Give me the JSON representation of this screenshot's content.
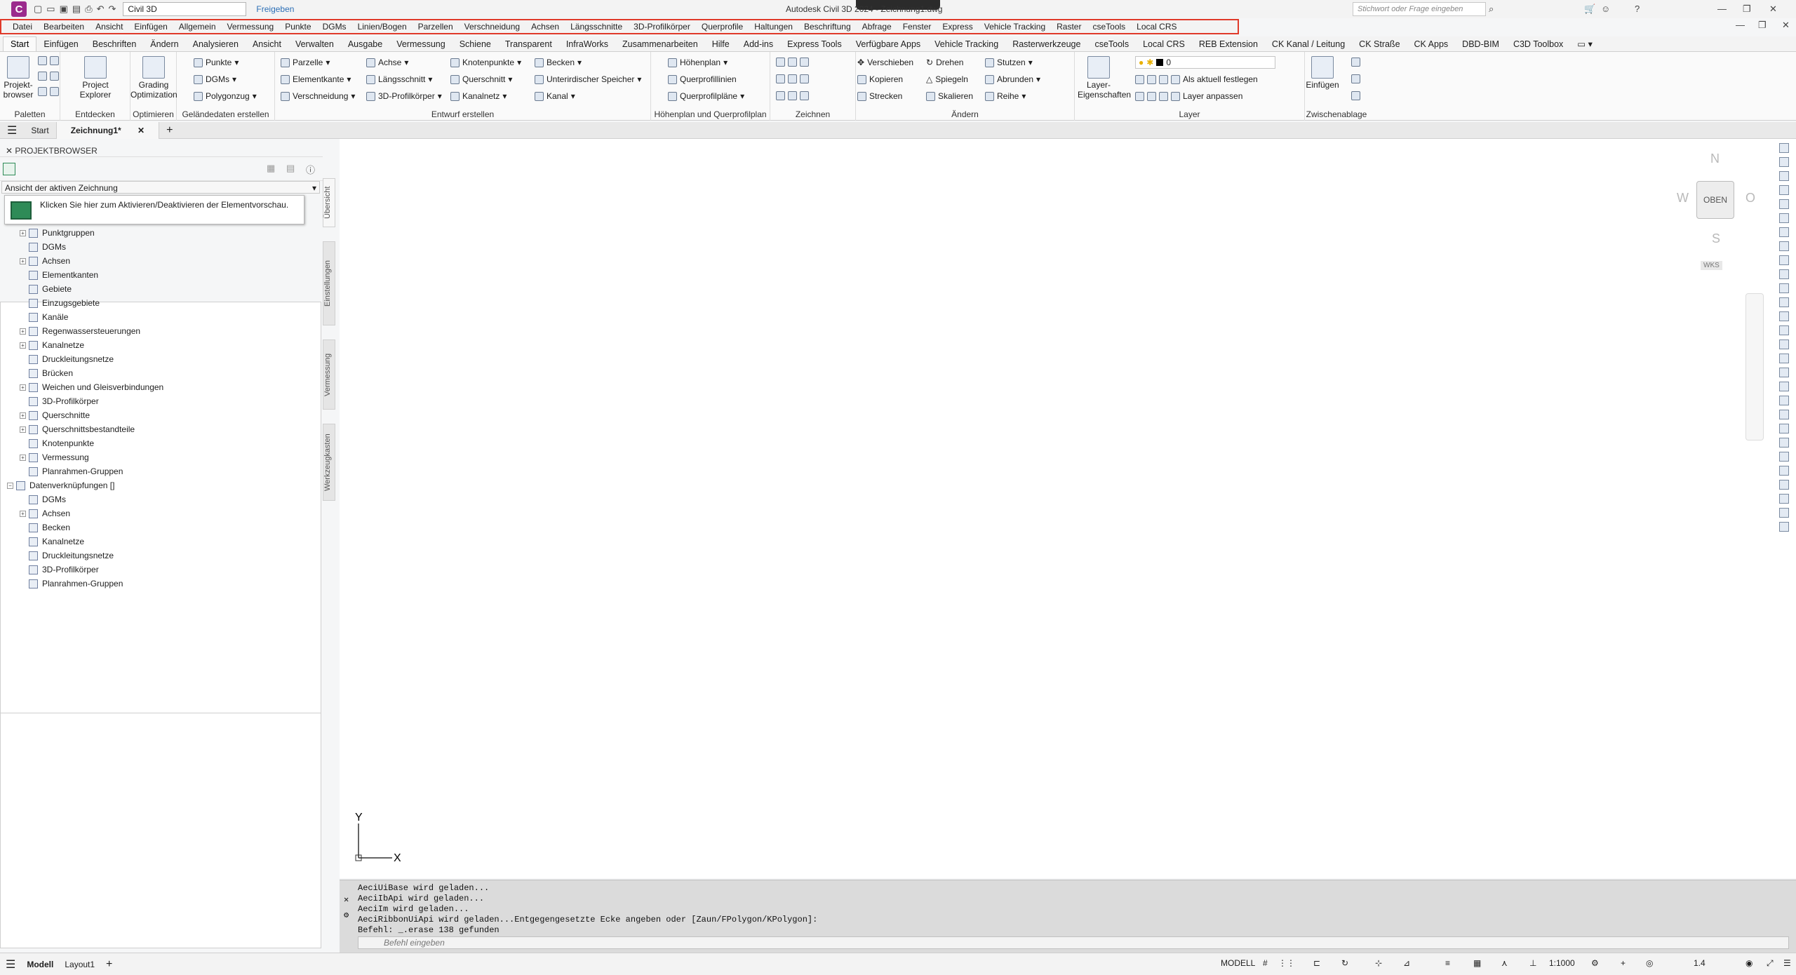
{
  "titlebar": {
    "logo": "C",
    "workspace": "Civil 3D",
    "share": "Freigeben",
    "app_title": "Autodesk Civil 3D 2024 - Zeichnung1.dwg",
    "search_placeholder": "Stichwort oder Frage eingeben"
  },
  "menu": [
    "Datei",
    "Bearbeiten",
    "Ansicht",
    "Einfügen",
    "Allgemein",
    "Vermessung",
    "Punkte",
    "DGMs",
    "Linien/Bogen",
    "Parzellen",
    "Verschneidung",
    "Achsen",
    "Längsschnitte",
    "3D-Profilkörper",
    "Querprofile",
    "Haltungen",
    "Beschriftung",
    "Abfrage",
    "Fenster",
    "Express",
    "Vehicle Tracking",
    "Raster",
    "cseTools",
    "Local CRS"
  ],
  "tabs": [
    "Start",
    "Einfügen",
    "Beschriften",
    "Ändern",
    "Analysieren",
    "Ansicht",
    "Verwalten",
    "Ausgabe",
    "Vermessung",
    "Schiene",
    "Transparent",
    "InfraWorks",
    "Zusammenarbeiten",
    "Hilfe",
    "Add-ins",
    "Express Tools",
    "Verfügbare Apps",
    "Vehicle Tracking",
    "Rasterwerkzeuge",
    "cseTools",
    "Local CRS",
    "REB Extension",
    "CK Kanal / Leitung",
    "CK Straße",
    "CK Apps",
    "DBD-BIM",
    "C3D Toolbox"
  ],
  "active_tab": "Start",
  "ribbon": {
    "panels": [
      "Paletten",
      "Entdecken",
      "Optimieren",
      "Geländedaten erstellen",
      "Entwurf erstellen",
      "Höhenplan und Querprofilplan",
      "Zeichnen",
      "Ändern",
      "Layer",
      "Zwischenablage"
    ],
    "big": {
      "projektbrowser": "Projekt-browser",
      "project_explorer": "Project Explorer",
      "grading": "Grading Optimization",
      "layer_props": "Layer-Eigenschaften",
      "einfuegen": "Einfügen"
    },
    "gelaende": [
      "Punkte",
      "DGMs",
      "Polygonzug"
    ],
    "entwurf_col1": [
      "Parzelle",
      "Elementkante",
      "Verschneidung"
    ],
    "entwurf_col2": [
      "Achse",
      "Längsschnitt",
      "3D-Profilkörper"
    ],
    "entwurf_col3": [
      "Knotenpunkte",
      "Querschnitt",
      "Kanalnetz"
    ],
    "entwurf_col4": [
      "Becken",
      "Unterirdischer Speicher",
      "Kanal"
    ],
    "hoehenplan": [
      "Höhenplan",
      "Querprofillinien",
      "Querprofilpläne"
    ],
    "aendern_col1": [
      "Verschieben",
      "Kopieren",
      "Strecken"
    ],
    "aendern_col2": [
      "Drehen",
      "Spiegeln",
      "Skalieren"
    ],
    "aendern_col3": [
      "Stutzen",
      "Abrunden",
      "Reihe"
    ],
    "layer_value": "0",
    "layer_actions": [
      "Als aktuell festlegen",
      "Layer anpassen"
    ]
  },
  "doc_tabs": [
    "Start",
    "Zeichnung1*"
  ],
  "palette": {
    "title": "PROJEKTBROWSER",
    "view_select": "Ansicht der aktiven Zeichnung",
    "tooltip": "Klicken Sie hier zum Aktivieren/Deaktivieren der Elementvorschau.",
    "side_tabs": [
      "Übersicht",
      "Einstellungen",
      "Vermessung",
      "Werkzeugkasten"
    ],
    "tree": [
      {
        "label": "Punktgruppen",
        "level": 1,
        "expand": true
      },
      {
        "label": "DGMs",
        "level": 1,
        "expand": false
      },
      {
        "label": "Achsen",
        "level": 1,
        "expand": true
      },
      {
        "label": "Elementkanten",
        "level": 1,
        "expand": false
      },
      {
        "label": "Gebiete",
        "level": 1,
        "expand": false
      },
      {
        "label": "Einzugsgebiete",
        "level": 1,
        "expand": false
      },
      {
        "label": "Kanäle",
        "level": 1,
        "expand": false
      },
      {
        "label": "Regenwassersteuerungen",
        "level": 1,
        "expand": true
      },
      {
        "label": "Kanalnetze",
        "level": 1,
        "expand": true
      },
      {
        "label": "Druckleitungsnetze",
        "level": 1,
        "expand": false
      },
      {
        "label": "Brücken",
        "level": 1,
        "expand": false
      },
      {
        "label": "Weichen und Gleisverbindungen",
        "level": 1,
        "expand": true
      },
      {
        "label": "3D-Profilkörper",
        "level": 1,
        "expand": false
      },
      {
        "label": "Querschnitte",
        "level": 1,
        "expand": true
      },
      {
        "label": "Querschnittsbestandteile",
        "level": 1,
        "expand": true
      },
      {
        "label": "Knotenpunkte",
        "level": 1,
        "expand": false
      },
      {
        "label": "Vermessung",
        "level": 1,
        "expand": true
      },
      {
        "label": "Planrahmen-Gruppen",
        "level": 1,
        "expand": false
      },
      {
        "label": "Datenverknüpfungen []",
        "level": 0,
        "expand": true
      },
      {
        "label": "DGMs",
        "level": 1,
        "expand": false
      },
      {
        "label": "Achsen",
        "level": 1,
        "expand": true
      },
      {
        "label": "Becken",
        "level": 1,
        "expand": false
      },
      {
        "label": "Kanalnetze",
        "level": 1,
        "expand": false
      },
      {
        "label": "Druckleitungsnetze",
        "level": 1,
        "expand": false
      },
      {
        "label": "3D-Profilkörper",
        "level": 1,
        "expand": false
      },
      {
        "label": "Planrahmen-Gruppen",
        "level": 1,
        "expand": false
      }
    ]
  },
  "viewcube": {
    "n": "N",
    "s": "S",
    "w": "W",
    "o": "O",
    "face": "OBEN",
    "wks": "WKS"
  },
  "ucs": {
    "x": "X",
    "y": "Y"
  },
  "command": {
    "history": [
      "AeciUiBase wird geladen...",
      "AeciIbApi wird geladen...",
      "AeciIm wird geladen...",
      "AeciRibbonUiApi wird geladen...Entgegengesetzte Ecke angeben oder [Zaun/FPolygon/KPolygon]:",
      "Befehl: _.erase 138 gefunden"
    ],
    "placeholder": "Befehl eingeben"
  },
  "status": {
    "tabs": [
      "Modell",
      "Layout1"
    ],
    "space": "MODELL",
    "scale": "1:1000",
    "num": "1.4"
  },
  "colors": {
    "accent": "#e03a2a",
    "logo": "#9b2b8d"
  }
}
